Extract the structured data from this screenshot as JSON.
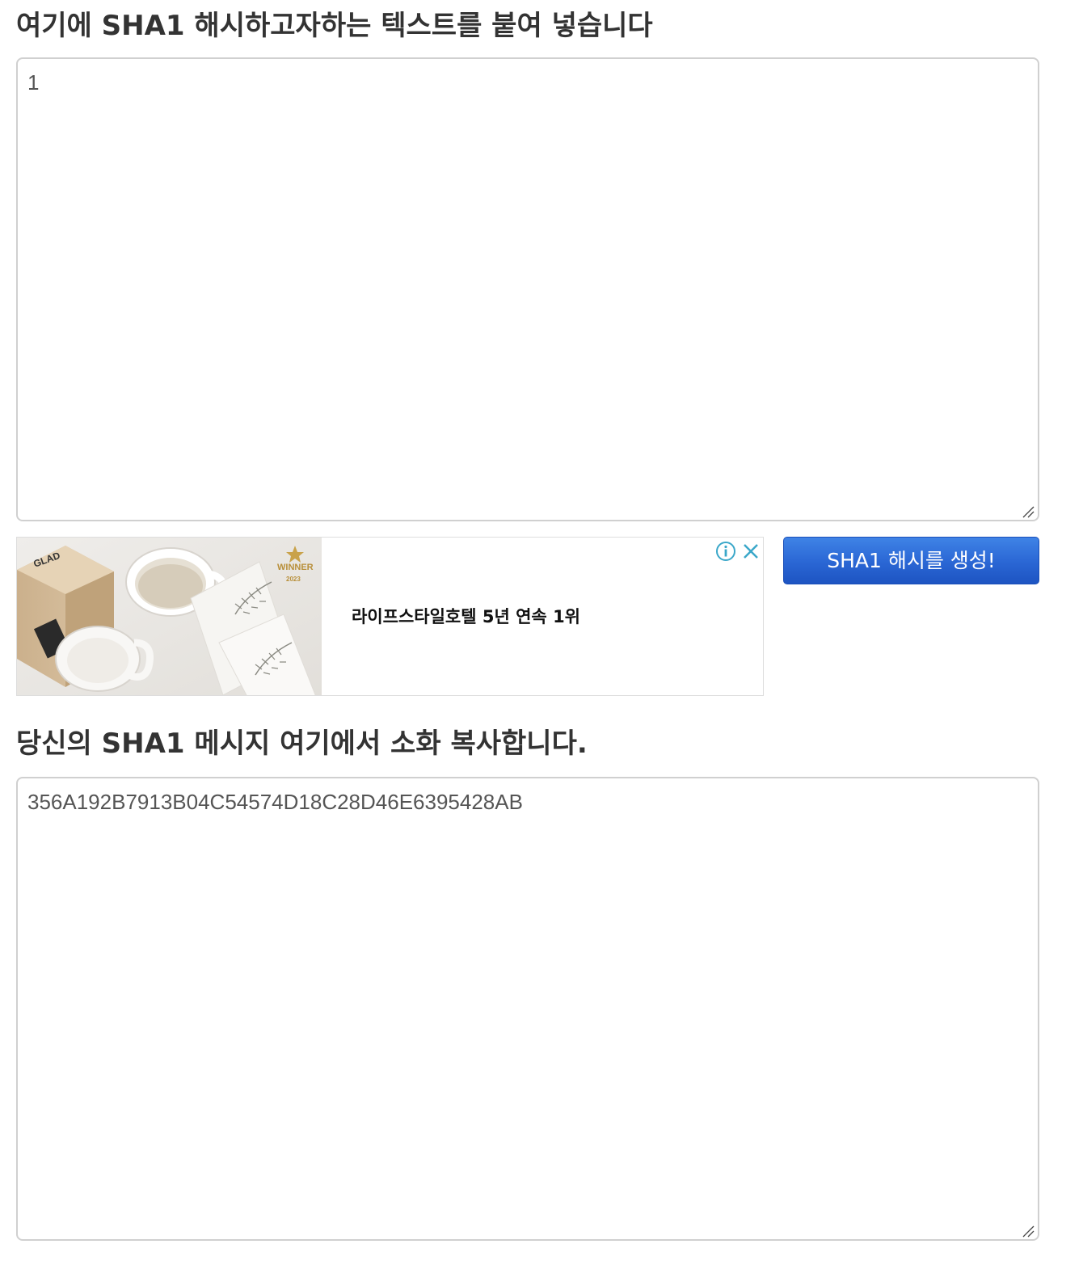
{
  "input_section": {
    "heading": "여기에 SHA1 해시하고자하는 텍스트를 붙여 넣습니다",
    "value": "1"
  },
  "ad": {
    "text": "라이프스타일호텔 5년 연속 1위",
    "image_brand": "GLAD",
    "badge_text": "WINNER",
    "badge_year": "2023",
    "info_icon": "info-icon",
    "close_icon": "close-icon",
    "accent_color": "#3aa7c9"
  },
  "generate_button": {
    "label": "SHA1 해시를 생성!",
    "color": "#2a66d4"
  },
  "output_section": {
    "heading": "당신의 SHA1 메시지 여기에서 소화 복사합니다.",
    "value": "356A192B7913B04C54574D18C28D46E6395428AB"
  }
}
